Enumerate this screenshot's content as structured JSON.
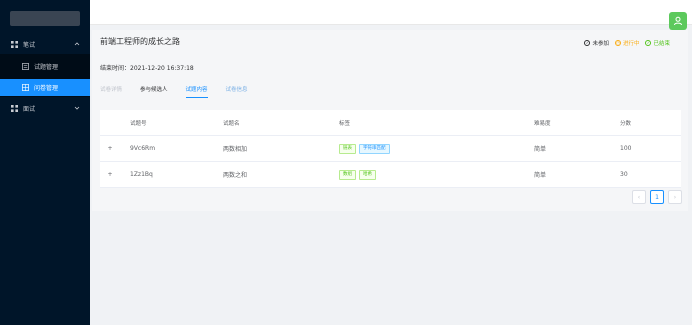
{
  "sidebar": {
    "menu": [
      {
        "label": "笔试",
        "expanded": true
      },
      {
        "label": "面试",
        "expanded": false
      }
    ],
    "submenu": [
      {
        "label": "试题管理",
        "active": false
      },
      {
        "label": "问卷管理",
        "active": true
      }
    ]
  },
  "page": {
    "title": "前端工程师的成长之路",
    "end_time": "结束时间：2021-12-20 16:37:18"
  },
  "status_legend": [
    {
      "label": "未参加",
      "color": "#303133"
    },
    {
      "label": "进行中",
      "color": "#faad14"
    },
    {
      "label": "已结束",
      "color": "#52c41a"
    }
  ],
  "tabs": [
    {
      "label": "试卷详情",
      "state": "disabled"
    },
    {
      "label": "参与候选人",
      "state": "normal"
    },
    {
      "label": "试题内容",
      "state": "active"
    },
    {
      "label": "试卷信息",
      "state": "link"
    }
  ],
  "table": {
    "headers": [
      "",
      "试题号",
      "试题名",
      "标签",
      "难易度",
      "分数"
    ],
    "rows": [
      {
        "expand": "+",
        "id": "9Vc6Rm",
        "name": "两数相加",
        "tags": [
          "链表",
          "字符串匹配"
        ],
        "difficulty": "简单",
        "score": "100"
      },
      {
        "expand": "+",
        "id": "1Zz1Bq",
        "name": "两数之和",
        "tags": [
          "数组",
          "哈希"
        ],
        "difficulty": "简单",
        "score": "30"
      }
    ]
  },
  "pagination": {
    "current": "1",
    "prev": "‹",
    "next": "›"
  },
  "colors": {
    "sidebar": "#001529",
    "accent": "#1890ff",
    "avatar": "#5cc95c"
  }
}
